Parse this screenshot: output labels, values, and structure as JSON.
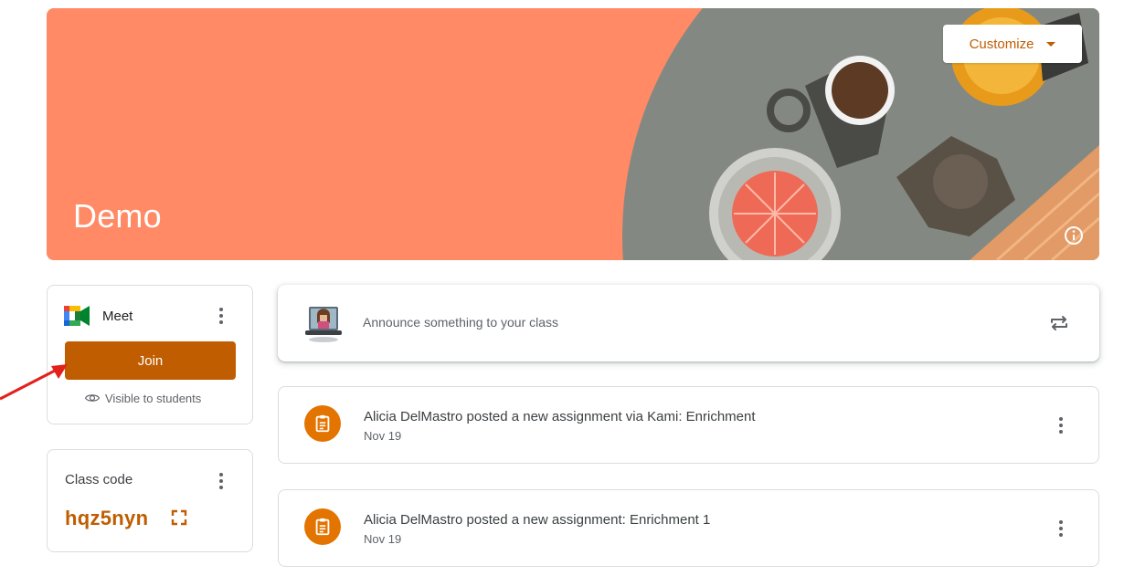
{
  "banner": {
    "title": "Demo",
    "customize_label": "Customize",
    "icons": [
      "coffee-table-illustration",
      "info-icon",
      "caret-down-icon"
    ]
  },
  "meet": {
    "label": "Meet",
    "join_label": "Join",
    "visibility_text": "Visible to students",
    "icons": [
      "google-meet-logo",
      "more-vert-icon",
      "eye-icon"
    ]
  },
  "class_code": {
    "label": "Class code",
    "code": "hqz5nyn",
    "icons": [
      "more-vert-icon",
      "fullscreen-icon"
    ]
  },
  "announce": {
    "placeholder": "Announce something to your class",
    "icons": [
      "teacher-avatar",
      "repost-icon"
    ]
  },
  "stream": [
    {
      "title": "Alicia DelMastro posted a new assignment via Kami: Enrichment",
      "date": "Nov 19",
      "icon": "assignment-icon"
    },
    {
      "title": "Alicia DelMastro posted a new assignment: Enrichment 1",
      "date": "Nov 19",
      "icon": "assignment-icon"
    }
  ],
  "colors": {
    "banner_bg": "#ff8a65",
    "accent": "#bf5d00",
    "assignment_icon_bg": "#e37400",
    "annotation_arrow": "#e3211c"
  }
}
